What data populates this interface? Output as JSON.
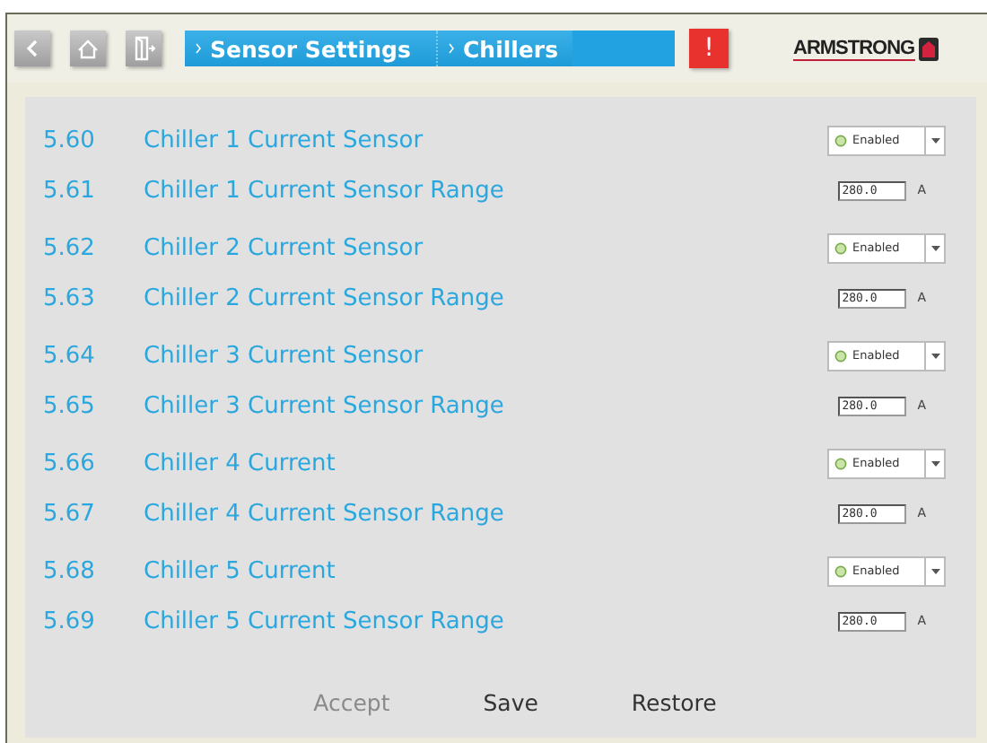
{
  "toolbar": {
    "breadcrumbs": [
      {
        "label": "Sensor Settings"
      },
      {
        "label": "Chillers"
      }
    ],
    "alert": "!",
    "logo": "ARMSTRONG"
  },
  "groups": [
    {
      "rows": [
        {
          "number": "5.60",
          "label": "Chiller 1 Current Sensor",
          "kind": "select",
          "value": "Enabled"
        },
        {
          "number": "5.61",
          "label": "Chiller 1 Current Sensor Range",
          "kind": "input",
          "value": "280.0",
          "unit": "A"
        }
      ]
    },
    {
      "rows": [
        {
          "number": "5.62",
          "label": "Chiller 2 Current Sensor",
          "kind": "select",
          "value": "Enabled"
        },
        {
          "number": "5.63",
          "label": "Chiller 2 Current Sensor Range",
          "kind": "input",
          "value": "280.0",
          "unit": "A"
        }
      ]
    },
    {
      "rows": [
        {
          "number": "5.64",
          "label": "Chiller 3 Current Sensor",
          "kind": "select",
          "value": "Enabled"
        },
        {
          "number": "5.65",
          "label": "Chiller 3 Current Sensor Range",
          "kind": "input",
          "value": "280.0",
          "unit": "A"
        }
      ]
    },
    {
      "rows": [
        {
          "number": "5.66",
          "label": "Chiller 4 Current",
          "kind": "select",
          "value": "Enabled"
        },
        {
          "number": "5.67",
          "label": "Chiller 4 Current Sensor Range",
          "kind": "input",
          "value": "280.0",
          "unit": "A"
        }
      ]
    },
    {
      "rows": [
        {
          "number": "5.68",
          "label": "Chiller 5 Current",
          "kind": "select",
          "value": "Enabled"
        },
        {
          "number": "5.69",
          "label": "Chiller 5 Current Sensor Range",
          "kind": "input",
          "value": "280.0",
          "unit": "A"
        }
      ]
    }
  ],
  "actions": [
    {
      "label": "Accept",
      "disabled": true
    },
    {
      "label": "Save",
      "disabled": false
    },
    {
      "label": "Restore",
      "disabled": false
    }
  ]
}
